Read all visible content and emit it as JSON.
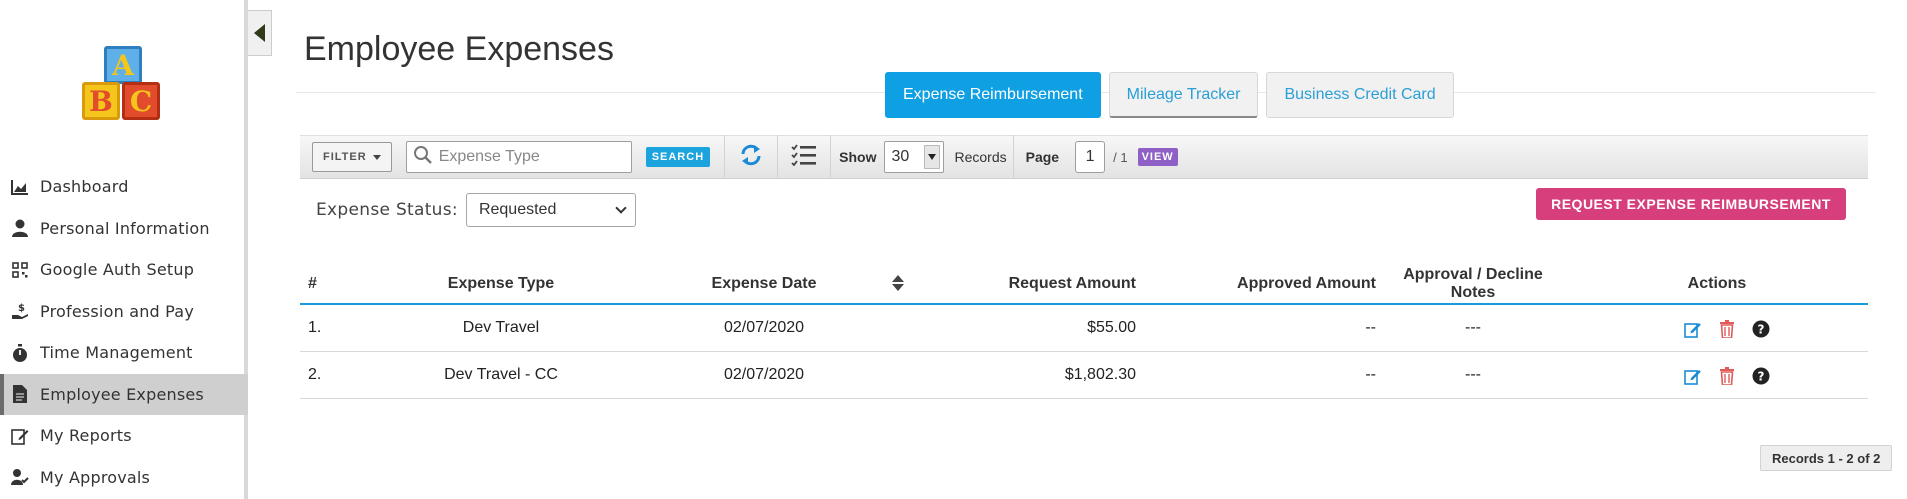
{
  "sidebar": {
    "logo": {
      "letters": [
        "A",
        "B",
        "C"
      ],
      "name": "abc-blocks-logo"
    },
    "items": [
      {
        "label": "Dashboard",
        "icon": "area-chart-icon"
      },
      {
        "label": "Personal Information",
        "icon": "user-icon"
      },
      {
        "label": "Google Auth Setup",
        "icon": "qr-code-icon"
      },
      {
        "label": "Profession and Pay",
        "icon": "hand-dollar-icon"
      },
      {
        "label": "Time Management",
        "icon": "stopwatch-icon"
      },
      {
        "label": "Employee Expenses",
        "icon": "document-icon",
        "active": true
      },
      {
        "label": "My Reports",
        "icon": "edit-report-icon"
      },
      {
        "label": "My Approvals",
        "icon": "user-check-icon"
      }
    ]
  },
  "page": {
    "title": "Employee Expenses"
  },
  "tabs": [
    {
      "label": "Expense Reimbursement",
      "active": true
    },
    {
      "label": "Mileage Tracker",
      "active": false
    },
    {
      "label": "Business Credit Card",
      "active": false
    }
  ],
  "toolbar": {
    "filter_label": "FILTER",
    "search_placeholder": "Expense Type",
    "search_value": "",
    "search_button": "SEARCH",
    "show_label": "Show",
    "show_value": "30",
    "records_label": "Records",
    "page_label": "Page",
    "page_value": "1",
    "page_total": "/ 1",
    "view_button": "VIEW"
  },
  "filter": {
    "label": "Expense Status:",
    "selected": "Requested"
  },
  "request_button": "REQUEST EXPENSE REIMBURSEMENT",
  "table": {
    "headers": [
      "#",
      "Expense Type",
      "Expense Date",
      "Request Amount",
      "Approved Amount",
      "Approval / Decline Notes",
      "Actions"
    ],
    "rows": [
      {
        "num": "1.",
        "type": "Dev Travel",
        "date": "02/07/2020",
        "request": "$55.00",
        "approved": "--",
        "notes": "---"
      },
      {
        "num": "2.",
        "type": "Dev Travel - CC",
        "date": "02/07/2020",
        "request": "$1,802.30",
        "approved": "--",
        "notes": "---"
      }
    ]
  },
  "records_summary": "Records 1 - 2 of 2",
  "colors": {
    "primary": "#0f9fe3",
    "accent_pink": "#d63f7c",
    "view_purple": "#8e5fc4",
    "edit_blue": "#1a8ad6",
    "delete_red": "#e05a5a"
  }
}
